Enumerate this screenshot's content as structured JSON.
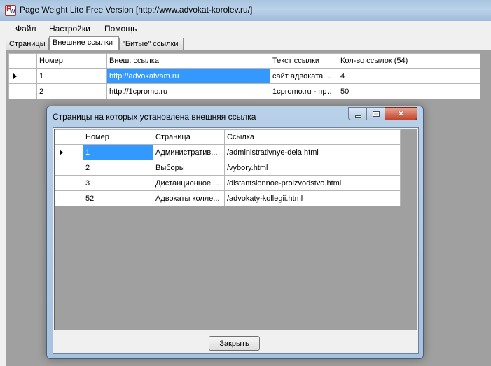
{
  "window": {
    "title": "Page Weight Lite Free Version [http://www.advokat-korolev.ru/]"
  },
  "menu": {
    "items": [
      "Файл",
      "Настройки",
      "Помощь"
    ]
  },
  "tabs": [
    "Страницы",
    "Внешние ссылки",
    "\"Битые\" ссылки"
  ],
  "active_tab": 1,
  "external_links": {
    "columns": [
      "Номер",
      "Внеш. ссылка",
      "Текст ссылки",
      "Кол-во ссылок (54)"
    ],
    "rows": [
      [
        "1",
        "http://advokatvam.ru",
        "сайт адвоката ...",
        "4"
      ],
      [
        "2",
        "http://1cpromo.ru",
        "1cpromo.ru - про...",
        "50"
      ]
    ]
  },
  "dialog": {
    "title": "Страницы на которых установлена внешняя ссылка",
    "columns": [
      "Номер",
      "Страница",
      "Ссылка"
    ],
    "rows": [
      [
        "1",
        "Административ...",
        "/administrativnye-dela.html"
      ],
      [
        "2",
        "Выборы",
        "/vybory.html"
      ],
      [
        "3",
        "Дистанционное ...",
        "/distantsionnoe-proizvodstvo.html"
      ],
      [
        "52",
        "Адвокаты колле...",
        "/advokaty-kollegii.html"
      ]
    ],
    "close_label": "Закрыть"
  },
  "colors": {
    "selection": "#3399ff",
    "grid_background": "#a0a0a0",
    "close_button_red": "#c2432a"
  }
}
